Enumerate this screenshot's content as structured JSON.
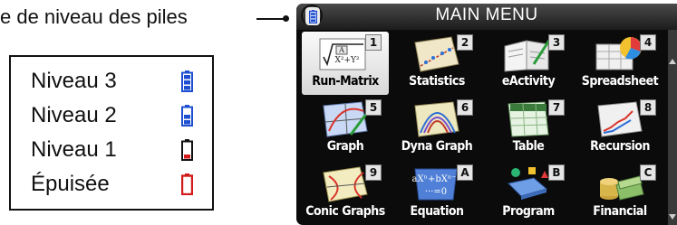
{
  "annotation": {
    "callout_text": "e de niveau des piles",
    "legend": [
      {
        "label": "Niveau 3",
        "icon": "battery-full-icon",
        "level": 3,
        "color": "#1f4fd1"
      },
      {
        "label": "Niveau 2",
        "icon": "battery-medium-icon",
        "level": 2,
        "color": "#1f4fd1"
      },
      {
        "label": "Niveau 1",
        "icon": "battery-low-icon",
        "level": 1,
        "color": "#d21a1a"
      },
      {
        "label": "Épuisée",
        "icon": "battery-empty-icon",
        "level": 0,
        "color": "#d21a1a"
      }
    ]
  },
  "screen": {
    "title": "MAIN MENU",
    "status_icon": "battery-status-icon",
    "menu": [
      {
        "label": "Run-Matrix",
        "key": "1",
        "icon": "run-matrix-icon",
        "selected": true
      },
      {
        "label": "Statistics",
        "key": "2",
        "icon": "statistics-icon"
      },
      {
        "label": "eActivity",
        "key": "3",
        "icon": "eactivity-icon"
      },
      {
        "label": "Spreadsheet",
        "key": "4",
        "icon": "spreadsheet-icon"
      },
      {
        "label": "Graph",
        "key": "5",
        "icon": "graph-icon"
      },
      {
        "label": "Dyna Graph",
        "key": "6",
        "icon": "dyna-graph-icon"
      },
      {
        "label": "Table",
        "key": "7",
        "icon": "table-icon"
      },
      {
        "label": "Recursion",
        "key": "8",
        "icon": "recursion-icon"
      },
      {
        "label": "Conic Graphs",
        "key": "9",
        "icon": "conic-graphs-icon"
      },
      {
        "label": "Equation",
        "key": "A",
        "icon": "equation-icon"
      },
      {
        "label": "Program",
        "key": "B",
        "icon": "program-icon"
      },
      {
        "label": "Financial",
        "key": "C",
        "icon": "financial-icon"
      }
    ]
  }
}
